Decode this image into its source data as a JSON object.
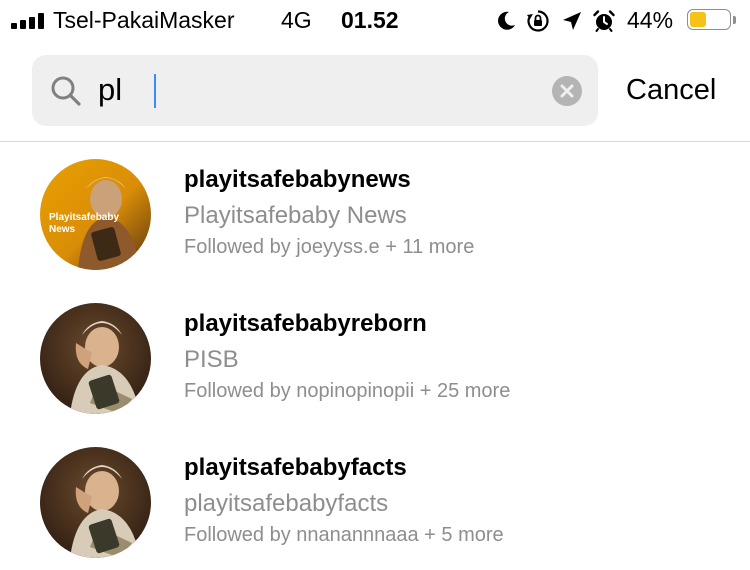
{
  "status_bar": {
    "carrier": "Tsel-PakaiMasker",
    "network": "4G",
    "time": "01.52",
    "battery_percent": "44%",
    "battery_level": 0.44,
    "battery_color": "#f6c218",
    "icons": [
      "moon-icon",
      "rotation-lock-icon",
      "location-arrow-icon",
      "alarm-icon"
    ]
  },
  "search": {
    "value": "pl",
    "cancel_label": "Cancel"
  },
  "results": [
    {
      "username": "playitsafebabynews",
      "full_name": "Playitsafebaby News",
      "followed_by": "Followed by joeyyss.e + 11 more",
      "avatar_overlay": "Playitsafebaby News"
    },
    {
      "username": "playitsafebabyreborn",
      "full_name": "PISB",
      "followed_by": "Followed by nopinopinopii + 25 more"
    },
    {
      "username": "playitsafebabyfacts",
      "full_name": "playitsafebabyfacts",
      "followed_by": "Followed by nnanannnaaa + 5 more"
    }
  ]
}
